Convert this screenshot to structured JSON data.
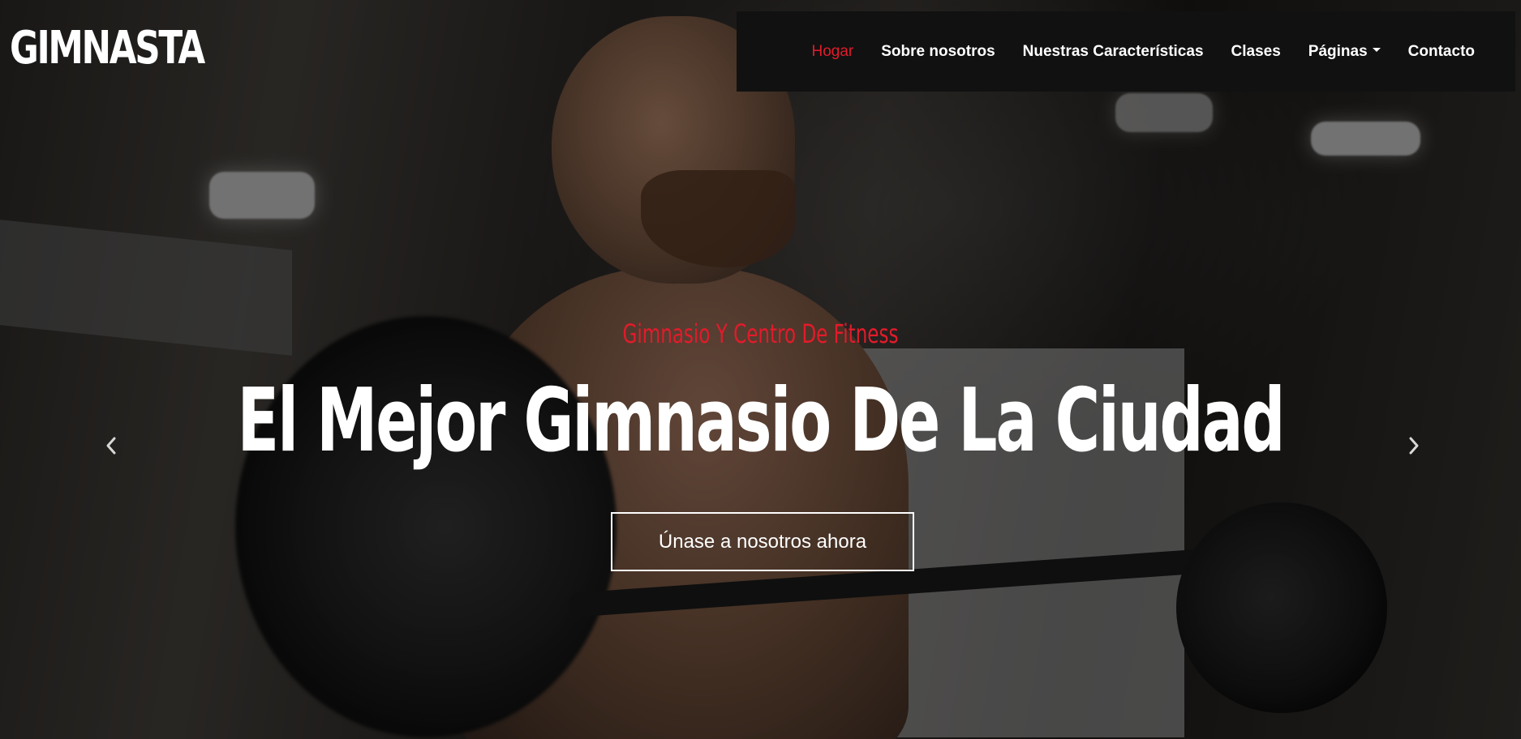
{
  "logo": {
    "text": "GIMNASTA"
  },
  "nav": {
    "items": [
      {
        "label": "Hogar",
        "active": true
      },
      {
        "label": "Sobre nosotros"
      },
      {
        "label": "Nuestras Características"
      },
      {
        "label": "Clases"
      },
      {
        "label": "Páginas",
        "dropdown": true
      },
      {
        "label": "Contacto"
      }
    ]
  },
  "hero": {
    "subtitle": "Gimnasio Y Centro De Fitness",
    "headline": "El Mejor Gimnasio De La Ciudad",
    "cta_label": "Únase a nosotros ahora"
  },
  "carousel": {
    "prev_icon": "chevron-left-icon",
    "next_icon": "chevron-right-icon"
  },
  "colors": {
    "accent": "#e21b2b",
    "nav_bg": "#111111",
    "text": "#ffffff"
  }
}
